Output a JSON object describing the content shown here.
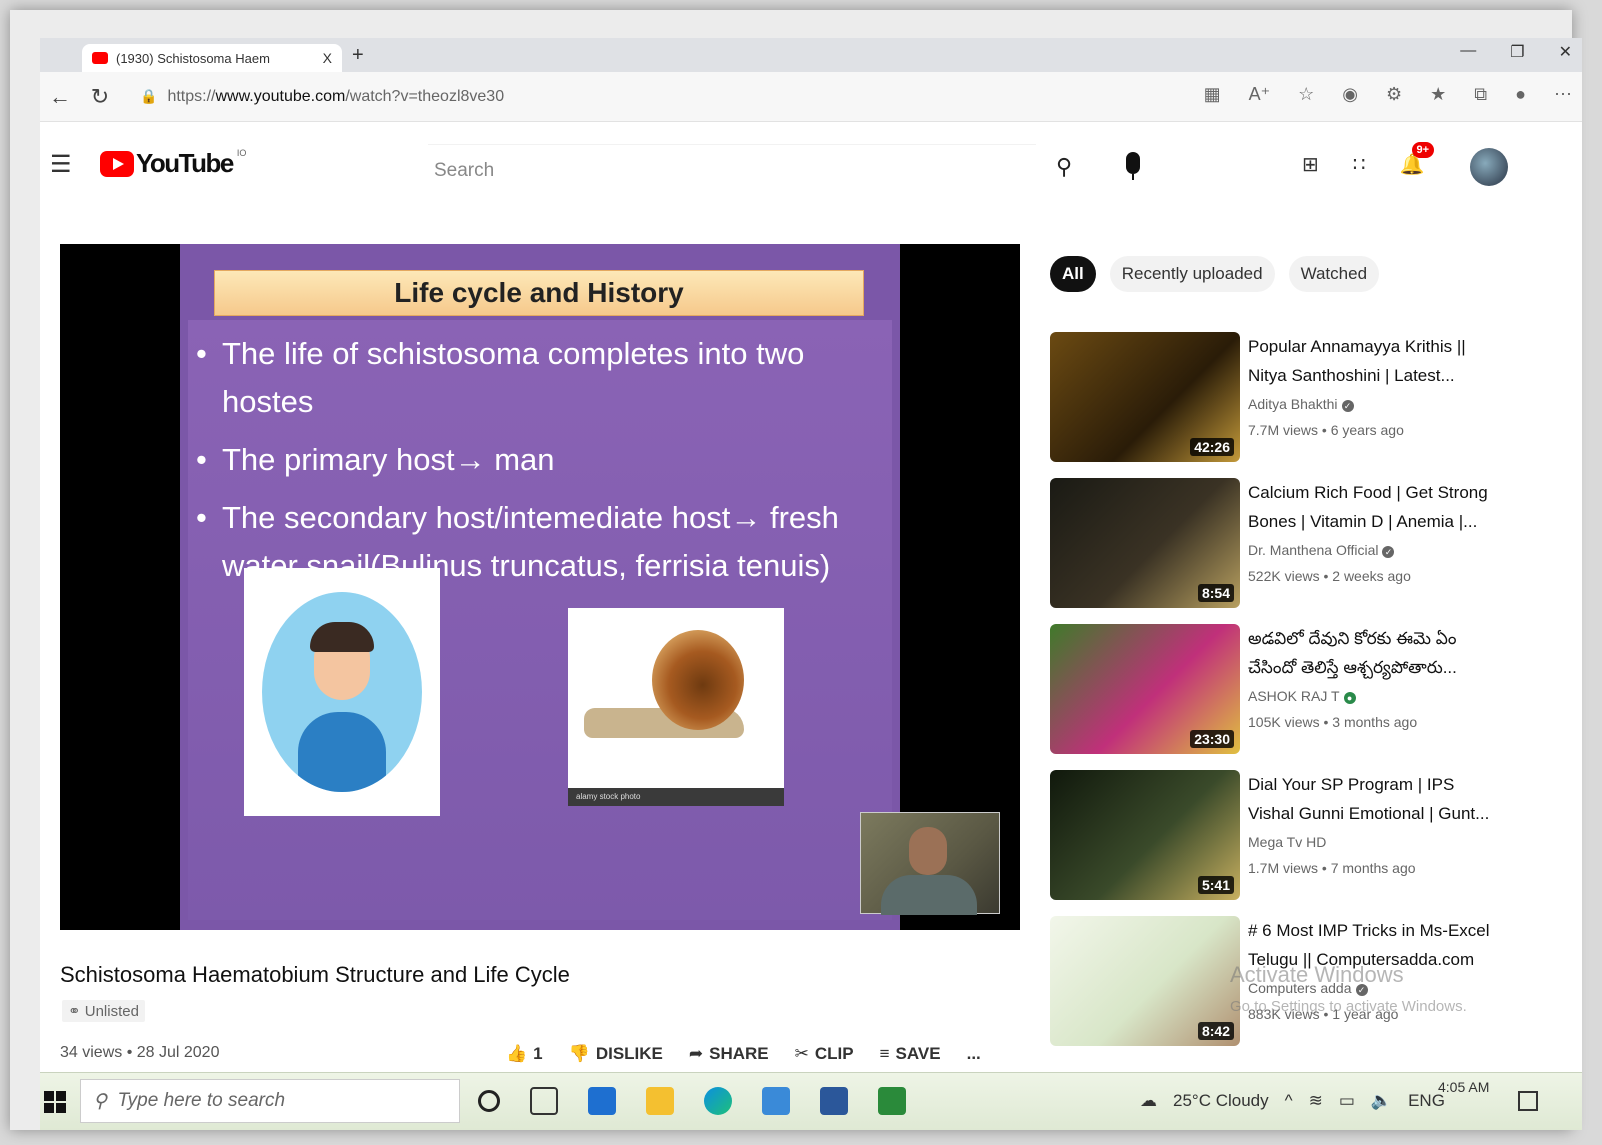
{
  "browser": {
    "tab_title": "(1930) Schistosoma Haem",
    "tab_close": "X",
    "new_tab": "+",
    "url_prefix": "https://",
    "url_host": "www.youtube.com",
    "url_path": "/watch?v=theozl8ve30"
  },
  "youtube": {
    "logo_text": "YouTube",
    "logo_sup": "IO",
    "search_placeholder": "Search",
    "notification_count": "9+"
  },
  "slide": {
    "heading": "Life cycle and History",
    "bullets": [
      "The life of schistosoma completes into two hostes",
      "The primary host→ man",
      "The secondary host/intemediate host→ fresh water snail(Bulinus truncatus, ferrisia tenuis)"
    ],
    "stock_caption": "alamy stock photo"
  },
  "video": {
    "title": "Schistosoma Haematobium Structure and Life Cycle",
    "visibility": "Unlisted",
    "views_date": "34 views • 28 Jul 2020",
    "like_count": "1",
    "dislike_label": "DISLIKE",
    "share_label": "SHARE",
    "clip_label": "CLIP",
    "save_label": "SAVE",
    "more": "..."
  },
  "chips": [
    "All",
    "Recently uploaded",
    "Watched"
  ],
  "sidebar": [
    {
      "title": "Popular Annamayya Krithis || Nitya Santhoshini | Latest...",
      "channel": "Aditya Bhakthi",
      "meta": "7.7M views • 6 years ago",
      "duration": "42:26",
      "color": "#3a2a10"
    },
    {
      "title": "Calcium Rich Food | Get Strong Bones | Vitamin D | Anemia |...",
      "channel": "Dr. Manthena Official",
      "meta": "522K views • 2 weeks ago",
      "duration": "8:54",
      "color": "#2a2218"
    },
    {
      "title": "అడవిలో దేవుని కోరకు ఈమె ఏం చేసిందో తెలిస్తే ఆశ్చర్యపోతారు...",
      "channel": "ASHOK RAJ T",
      "meta": "105K views • 3 months ago",
      "duration": "23:30",
      "color": "#5a3a6a"
    },
    {
      "title": "Dial Your SP Program | IPS Vishal Gunni Emotional | Gunt...",
      "channel": "Mega Tv HD",
      "meta": "1.7M views • 7 months ago",
      "duration": "5:41",
      "color": "#1f2a1a"
    },
    {
      "title": "# 6 Most IMP Tricks in Ms-Excel Telugu || Computersadda.com",
      "channel": "Computers adda",
      "meta": "883K views • 1 year ago",
      "duration": "8:42",
      "color": "#e8efe0"
    }
  ],
  "watermark": {
    "line1": "Activate Windows",
    "line2": "Go to Settings to activate Windows."
  },
  "taskbar": {
    "search_placeholder": "Type here to search",
    "weather": "25°C  Cloudy",
    "lang": "ENG",
    "time": "4:05 AM"
  }
}
